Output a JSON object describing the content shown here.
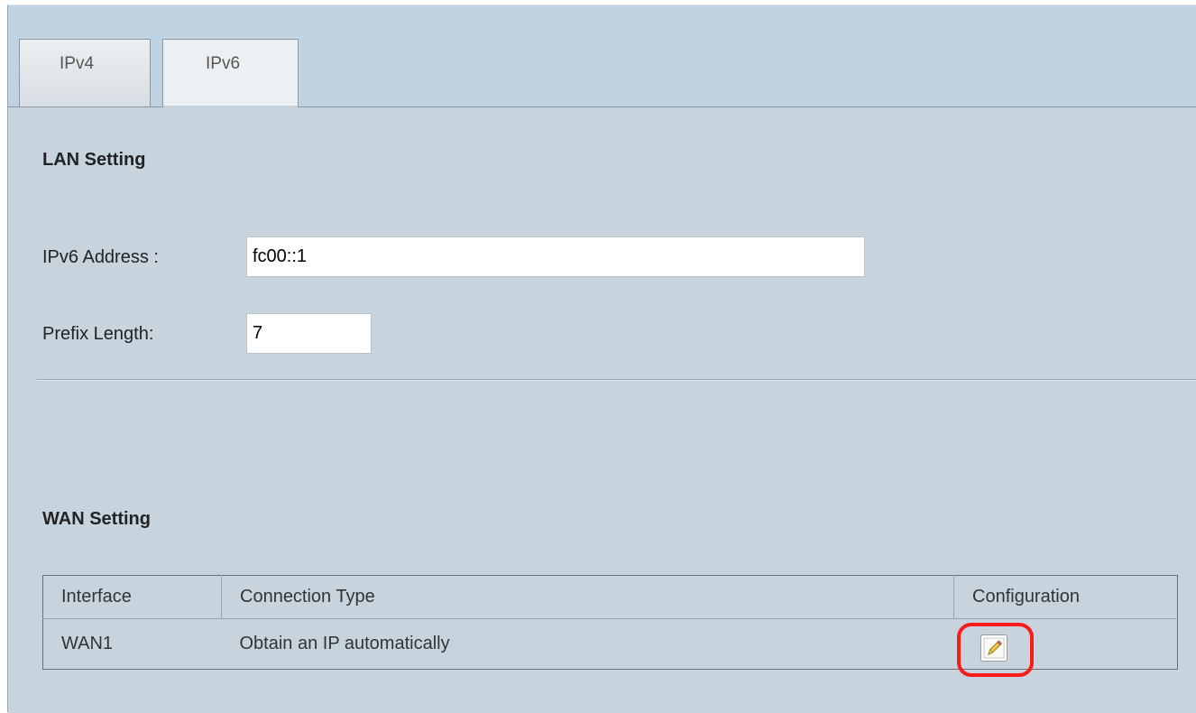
{
  "tabs": [
    {
      "label": "IPv4",
      "active": false
    },
    {
      "label": "IPv6",
      "active": true
    }
  ],
  "lan": {
    "title": "LAN Setting",
    "ipv6_address_label": "IPv6 Address :",
    "ipv6_address_value": "fc00::1",
    "prefix_length_label": "Prefix Length:",
    "prefix_length_value": "7"
  },
  "wan": {
    "title": "WAN Setting",
    "columns": [
      "Interface",
      "Connection Type",
      "Configuration"
    ],
    "rows": [
      {
        "interface": "WAN1",
        "connection_type": "Obtain an IP automatically",
        "configuration_icon": "pencil-edit-icon"
      }
    ]
  },
  "colors": {
    "background": "#c7d4de",
    "tab_strip": "#c0d3e3",
    "highlight": "#ff1a1a"
  }
}
